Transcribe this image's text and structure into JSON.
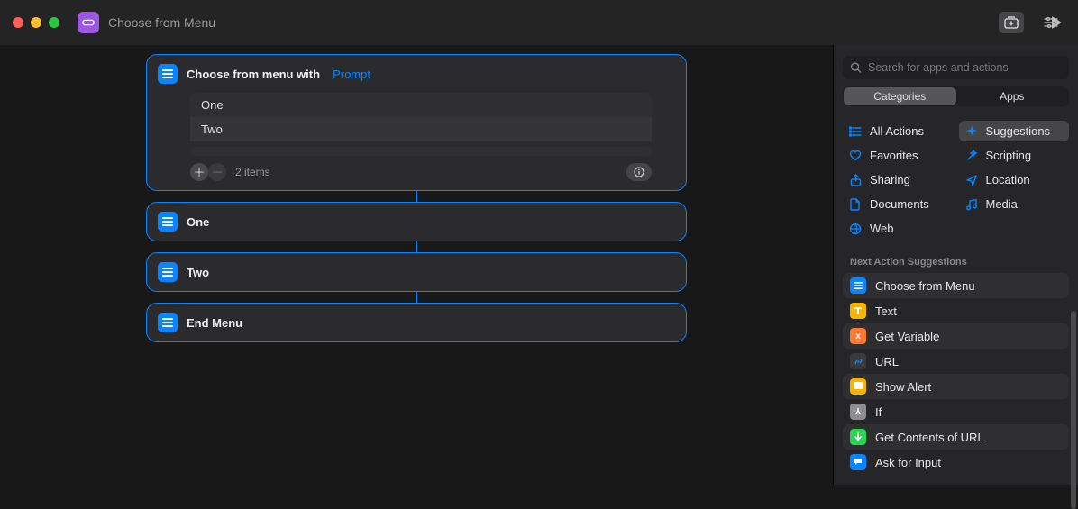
{
  "header": {
    "title": "Choose from Menu"
  },
  "workflow": {
    "main_action": {
      "title": "Choose from menu with",
      "param_token": "Prompt",
      "options": [
        "One",
        "Two"
      ],
      "count_label": "2 items"
    },
    "branches": [
      "One",
      "Two"
    ],
    "end_label": "End Menu"
  },
  "sidebar": {
    "search_placeholder": "Search for apps and actions",
    "segments": {
      "categories": "Categories",
      "apps": "Apps"
    },
    "categories": [
      {
        "label": "All Actions",
        "icon": "list"
      },
      {
        "label": "Suggestions",
        "icon": "sparkle",
        "active": true
      },
      {
        "label": "Favorites",
        "icon": "heart"
      },
      {
        "label": "Scripting",
        "icon": "wand"
      },
      {
        "label": "Sharing",
        "icon": "share"
      },
      {
        "label": "Location",
        "icon": "location"
      },
      {
        "label": "Documents",
        "icon": "doc"
      },
      {
        "label": "Media",
        "icon": "music"
      },
      {
        "label": "Web",
        "icon": "globe"
      }
    ],
    "section_title": "Next Action Suggestions",
    "suggestions": [
      {
        "label": "Choose from Menu",
        "color": "#0a84ff",
        "glyph": "menu"
      },
      {
        "label": "Text",
        "color": "#f7b500",
        "glyph": "text"
      },
      {
        "label": "Get Variable",
        "color": "#ff7a2f",
        "glyph": "var"
      },
      {
        "label": "URL",
        "color": "#3a3a3c",
        "glyph": "link"
      },
      {
        "label": "Show Alert",
        "color": "#f7b500",
        "glyph": "alert"
      },
      {
        "label": "If",
        "color": "#8e8e93",
        "glyph": "branch"
      },
      {
        "label": "Get Contents of URL",
        "color": "#30d158",
        "glyph": "down"
      },
      {
        "label": "Ask for Input",
        "color": "#0a84ff",
        "glyph": "chat"
      }
    ]
  }
}
